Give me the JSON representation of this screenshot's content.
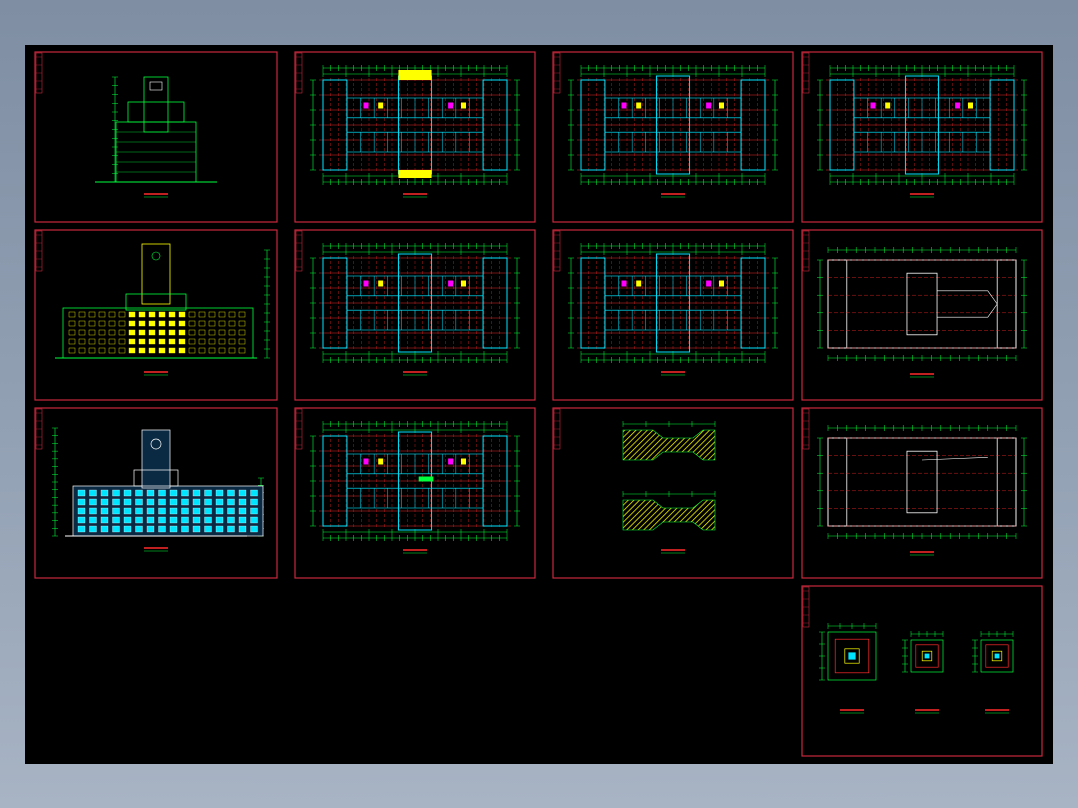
{
  "viewer": {
    "background_color": "#000000",
    "frame_color": "#c8283c",
    "line_green": "#00ff3c",
    "line_red": "#ff2a2a",
    "line_cyan": "#00e5ff",
    "line_yellow": "#ffff00",
    "line_magenta": "#ff00ff"
  },
  "sheets": [
    {
      "id": "s1",
      "kind": "section-tower"
    },
    {
      "id": "s2",
      "kind": "floor-plan"
    },
    {
      "id": "s3",
      "kind": "floor-plan"
    },
    {
      "id": "s4",
      "kind": "floor-plan"
    },
    {
      "id": "s5",
      "kind": "elevation"
    },
    {
      "id": "s6",
      "kind": "floor-plan"
    },
    {
      "id": "s7",
      "kind": "floor-plan"
    },
    {
      "id": "s8",
      "kind": "roof-plan"
    },
    {
      "id": "s9",
      "kind": "elevation-front"
    },
    {
      "id": "s10",
      "kind": "floor-plan"
    },
    {
      "id": "s11",
      "kind": "detail"
    },
    {
      "id": "s12",
      "kind": "roof-plan"
    },
    {
      "id": "s13",
      "kind": "tower-plans"
    }
  ]
}
